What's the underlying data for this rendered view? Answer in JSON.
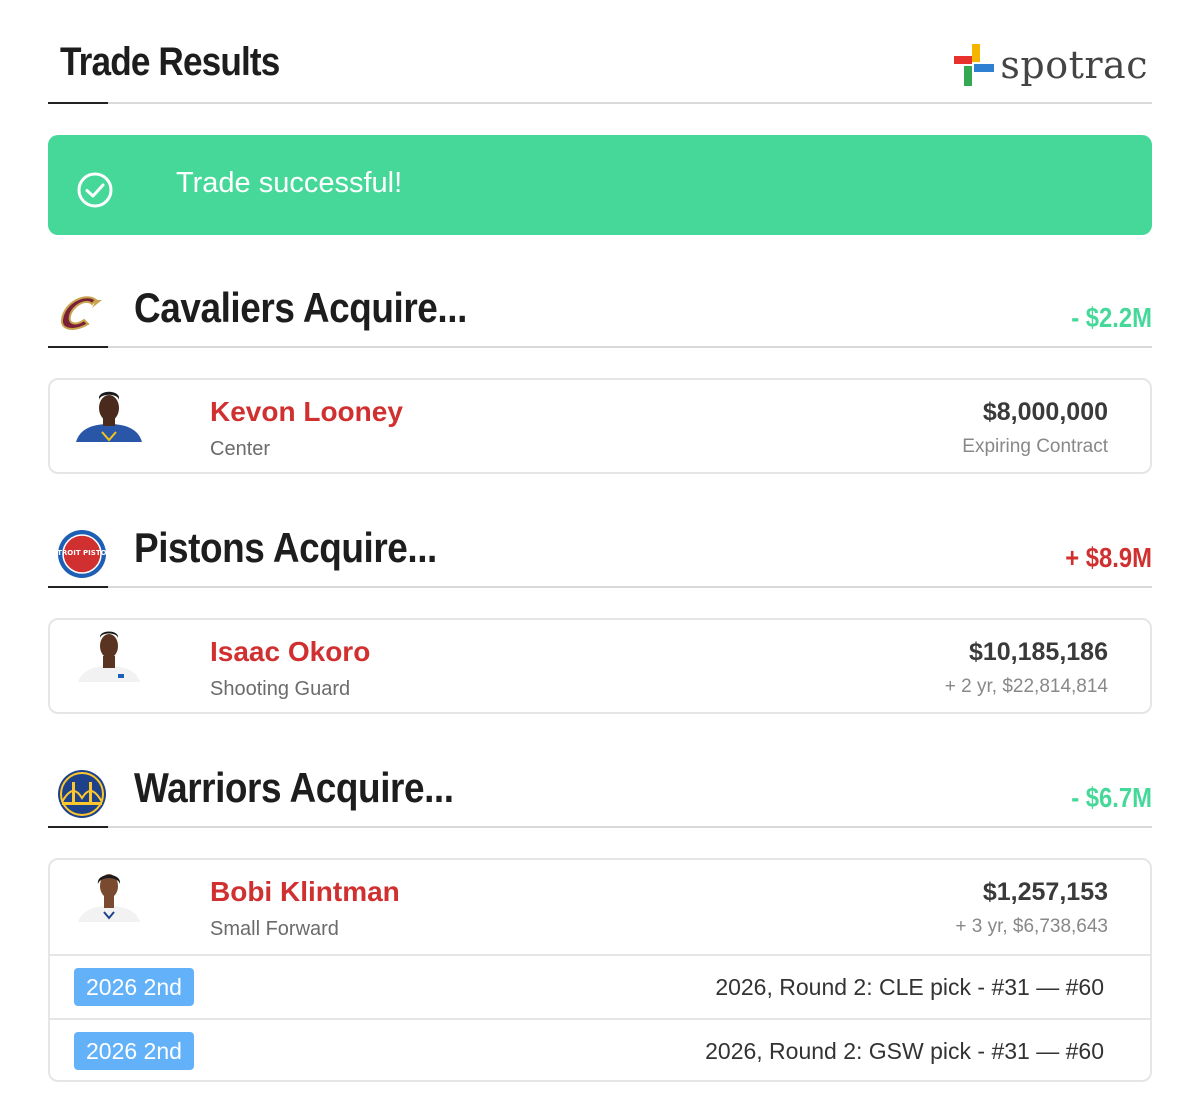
{
  "header": {
    "title": "Trade Results",
    "logo_text": "spotrac",
    "logo_colors": [
      "#e8302c",
      "#2f7fd3",
      "#f4b400",
      "#34a853"
    ]
  },
  "alert": {
    "icon": "check-circle-icon",
    "message": "Trade successful!",
    "color": "#45d899"
  },
  "teams": [
    {
      "title": "Cavaliers Acquire...",
      "logo": "cavaliers-logo-icon",
      "cap_change": "- $2.2M",
      "cap_color": "#45d899",
      "players": [
        {
          "name": "Kevon Looney",
          "position": "Center",
          "salary": "$8,000,000",
          "contract": "Expiring Contract"
        }
      ],
      "picks": []
    },
    {
      "title": "Pistons Acquire...",
      "logo": "pistons-logo-icon",
      "logo_text": "DETROIT PISTONS",
      "cap_change": "+ $8.9M",
      "cap_color": "#d0302f",
      "players": [
        {
          "name": "Isaac Okoro",
          "position": "Shooting Guard",
          "salary": "$10,185,186",
          "contract": "+ 2 yr, $22,814,814"
        }
      ],
      "picks": []
    },
    {
      "title": "Warriors Acquire...",
      "logo": "warriors-logo-icon",
      "cap_change": "- $6.7M",
      "cap_color": "#45d899",
      "players": [
        {
          "name": "Bobi Klintman",
          "position": "Small Forward",
          "salary": "$1,257,153",
          "contract": "+ 3 yr, $6,738,643"
        }
      ],
      "picks": [
        {
          "badge": "2026 2nd",
          "description": "2026, Round 2: CLE pick - #31 — #60"
        },
        {
          "badge": "2026 2nd",
          "description": "2026, Round 2: GSW pick - #31 — #60"
        }
      ]
    }
  ],
  "colors": {
    "name_red": "#d0302f",
    "pick_badge_blue": "#63b1f8"
  }
}
